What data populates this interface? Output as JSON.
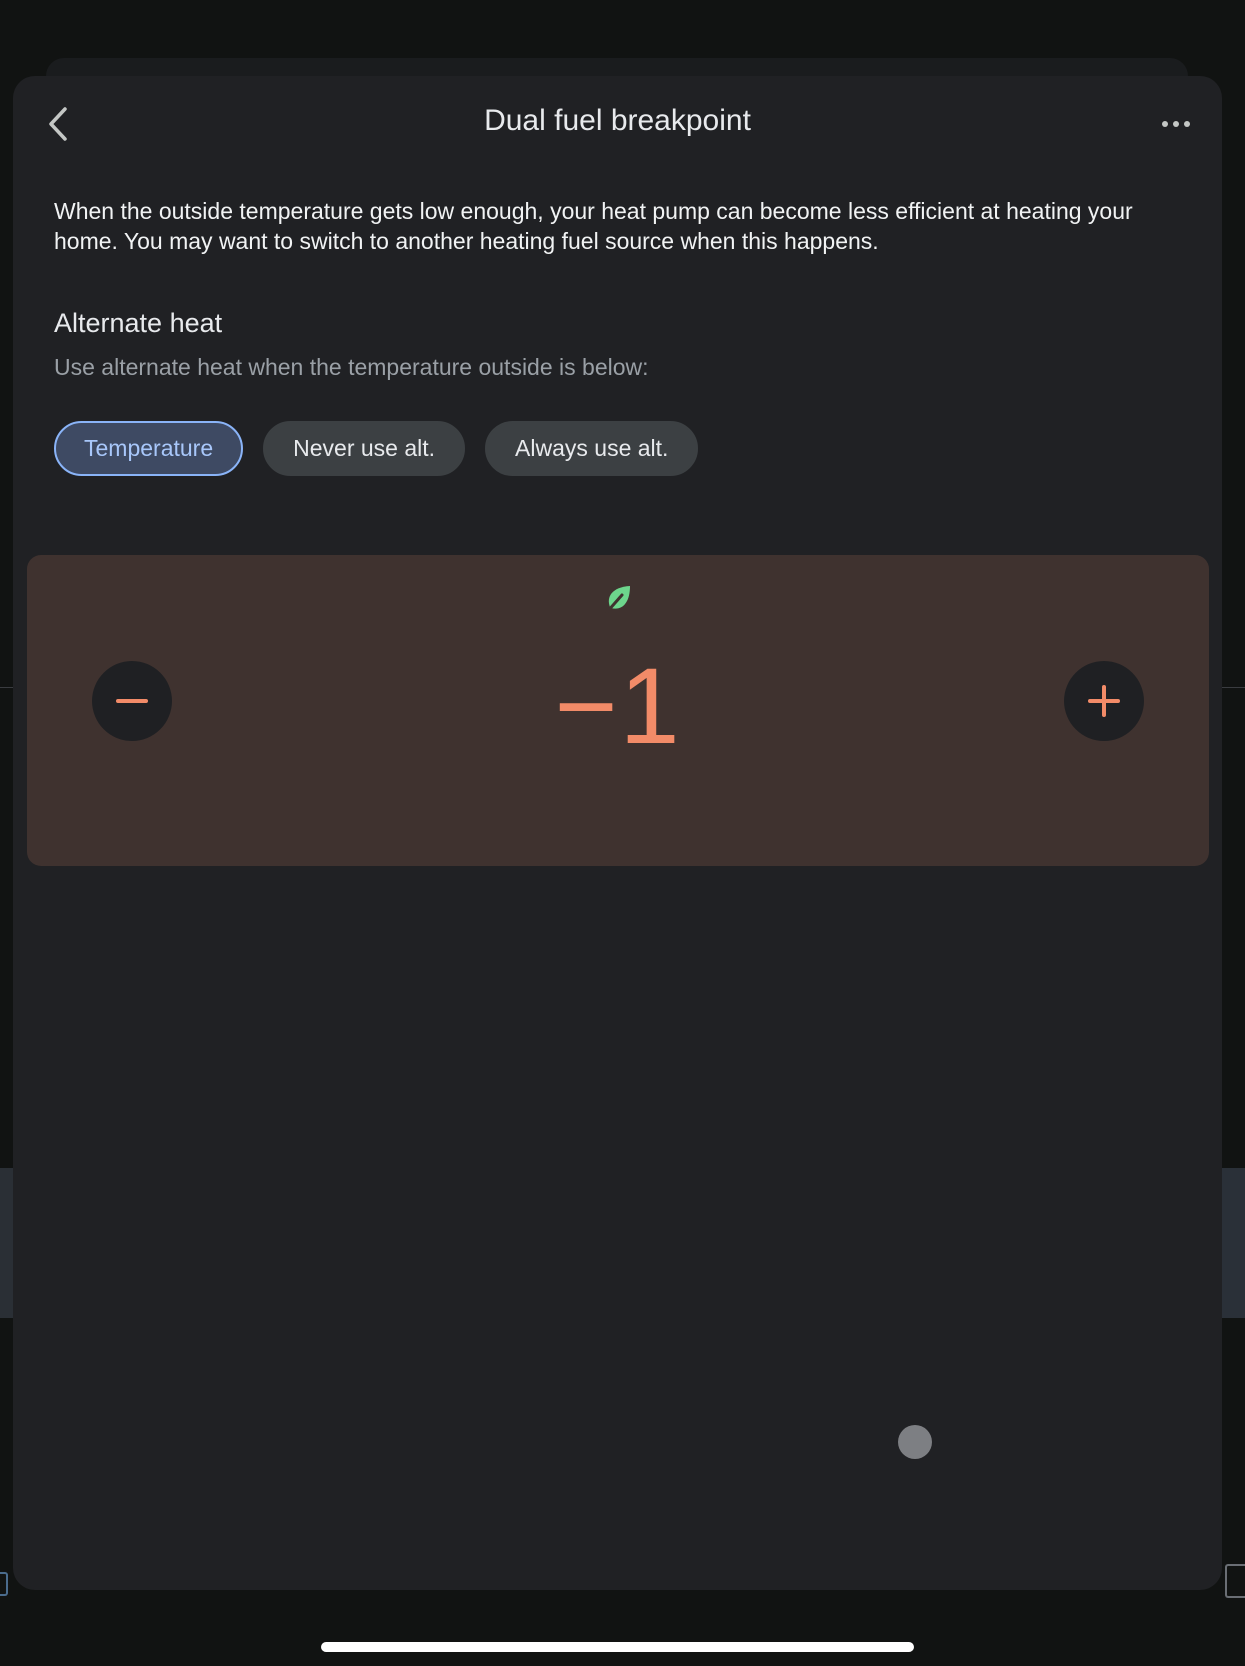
{
  "header": {
    "title": "Dual fuel breakpoint"
  },
  "description": "When the outside temperature gets low enough, your heat pump can become less efficient at heating your home. You may want to switch to another heating fuel source when this happens.",
  "alternate_heat": {
    "title": "Alternate heat",
    "subtitle": "Use alternate heat when the temperature outside is below:",
    "options": [
      {
        "label": "Temperature",
        "selected": true
      },
      {
        "label": "Never use alt.",
        "selected": false
      },
      {
        "label": "Always use alt.",
        "selected": false
      }
    ]
  },
  "temperature": {
    "value": "−1",
    "eco_icon": "leaf-icon"
  },
  "icons": {
    "back": "chevron-left-icon",
    "more": "more-horizontal-icon",
    "decrease": "minus-icon",
    "increase": "plus-icon"
  },
  "colors": {
    "accent": "#f28b68",
    "selected_chip": "#8ab4f8",
    "eco_green": "#6dd58c",
    "card_bg": "#3f322f"
  }
}
